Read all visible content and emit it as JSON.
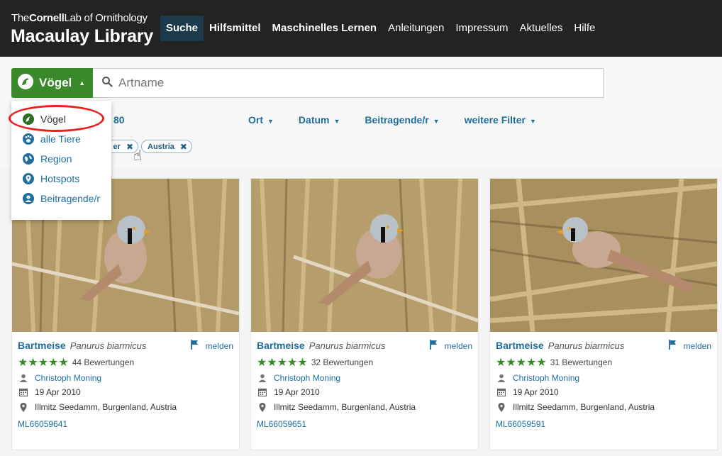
{
  "header": {
    "logo_top_pre": "The",
    "logo_top_bold": "Cornell",
    "logo_top_post": "Lab of Ornithology",
    "logo_main": "Macaulay Library",
    "nav": [
      {
        "label": "Suche"
      },
      {
        "label": "Hilfsmittel"
      },
      {
        "label": "Maschinelles Lernen"
      },
      {
        "label": "Anleitungen"
      },
      {
        "label": "Impressum"
      },
      {
        "label": "Aktuelles"
      },
      {
        "label": "Hilfe"
      }
    ]
  },
  "search": {
    "taxon_label": "Vögel",
    "placeholder": "Artname"
  },
  "dropdown": {
    "items": [
      {
        "label": "Vögel",
        "icon": "bird-icon"
      },
      {
        "label": "alle Tiere",
        "icon": "animals-icon"
      },
      {
        "label": "Region",
        "icon": "globe-icon"
      },
      {
        "label": "Hotspots",
        "icon": "location-pin-icon"
      },
      {
        "label": "Beitragende/r",
        "icon": "user-icon"
      }
    ]
  },
  "results": {
    "count": "80",
    "filters": [
      {
        "label": "Ort"
      },
      {
        "label": "Datum"
      },
      {
        "label": "Beitragende/r"
      },
      {
        "label": "weitere Filter"
      }
    ],
    "chips": [
      {
        "label": "er"
      },
      {
        "label": "Austria"
      }
    ]
  },
  "cards": [
    {
      "common": "Bartmeise",
      "sci": "Panurus biarmicus",
      "report": "melden",
      "stars": "★★★★★",
      "ratings": "44 Bewertungen",
      "user": "Christoph Moning",
      "date": "19 Apr 2010",
      "location": "Illmitz Seedamm, Burgenland, Austria",
      "asset": "ML66059641"
    },
    {
      "common": "Bartmeise",
      "sci": "Panurus biarmicus",
      "report": "melden",
      "stars": "★★★★★",
      "ratings": "32 Bewertungen",
      "user": "Christoph Moning",
      "date": "19 Apr 2010",
      "location": "Illmitz Seedamm, Burgenland, Austria",
      "asset": "ML66059651"
    },
    {
      "common": "Bartmeise",
      "sci": "Panurus biarmicus",
      "report": "melden",
      "stars": "★★★★★",
      "ratings": "31 Bewertungen",
      "user": "Christoph Moning",
      "date": "19 Apr 2010",
      "location": "Illmitz Seedamm, Burgenland, Austria",
      "asset": "ML66059591"
    }
  ],
  "colors": {
    "header_bg": "#232323",
    "nav_active": "#1b3a4b",
    "brand_green": "#3a8a2b",
    "link_blue": "#1f6e9e",
    "highlight_red": "#e8201e"
  }
}
